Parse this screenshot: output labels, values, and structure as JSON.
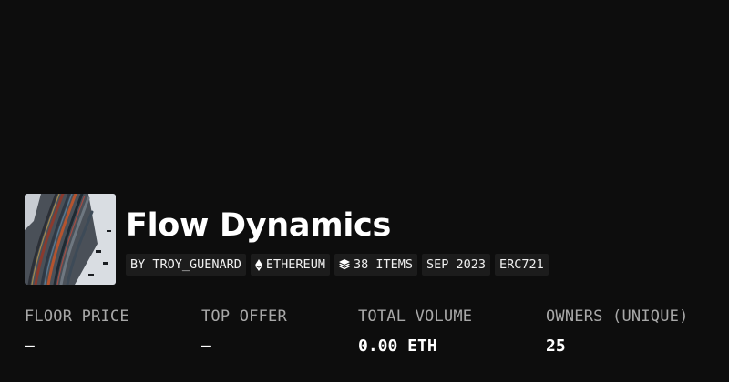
{
  "collection": {
    "title": "Flow Dynamics",
    "thumbnail_icon": "aerial-cargo-yard-thumbnail",
    "chips": {
      "creator": "BY TROY_GUENARD",
      "chain": "ETHEREUM",
      "chain_icon": "ethereum-icon",
      "items": "38 ITEMS",
      "items_icon": "layers-icon",
      "date": "SEP 2023",
      "standard": "ERC721"
    }
  },
  "stats": {
    "floor_price": {
      "label": "FLOOR PRICE",
      "value": "—"
    },
    "top_offer": {
      "label": "TOP OFFER",
      "value": "—"
    },
    "total_volume": {
      "label": "TOTAL VOLUME",
      "value": "0.00 ETH"
    },
    "owners": {
      "label": "OWNERS (UNIQUE)",
      "value": "25"
    }
  },
  "colors": {
    "background": "#0d0d0d",
    "chip_background": "#1c1c1c",
    "label_gray": "#a8a8a8",
    "text_white": "#ffffff"
  }
}
